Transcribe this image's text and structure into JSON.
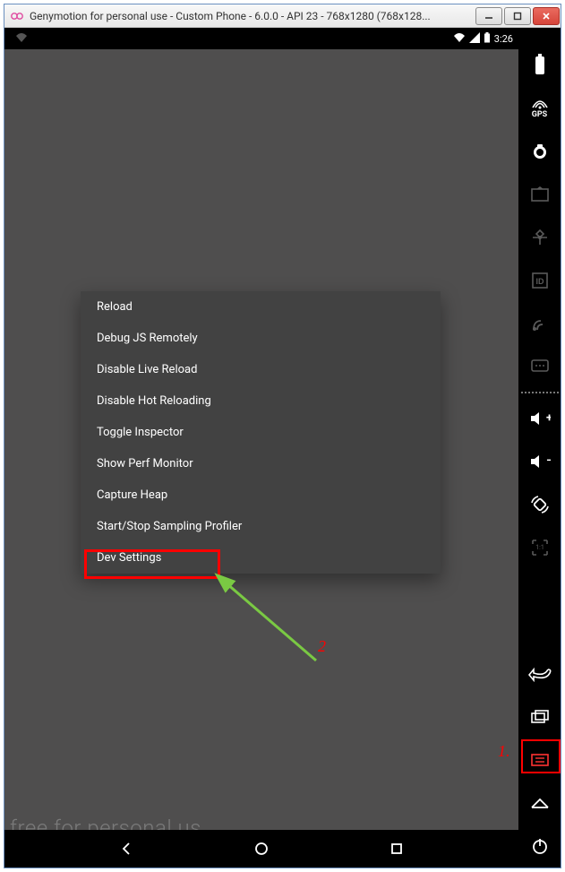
{
  "window": {
    "title": "Genymotion for personal use - Custom Phone - 6.0.0 - API 23 - 768x1280 (768x128..."
  },
  "statusbar": {
    "clock": "3:26"
  },
  "devmenu": {
    "items": [
      "Reload",
      "Debug JS Remotely",
      "Disable Live Reload",
      "Disable Hot Reloading",
      "Toggle Inspector",
      "Show Perf Monitor",
      "Capture Heap",
      "Start/Stop Sampling Profiler",
      "Dev Settings"
    ]
  },
  "toolbar": {
    "gps_label": "GPS"
  },
  "watermark": "free for personal us",
  "annotations": {
    "num1": "1.",
    "num2": "2"
  }
}
